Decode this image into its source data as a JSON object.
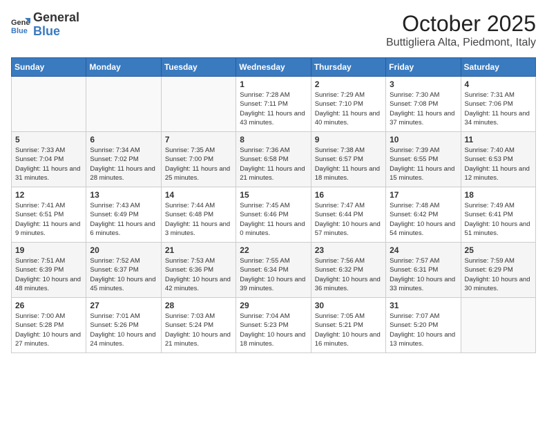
{
  "header": {
    "logo_general": "General",
    "logo_blue": "Blue",
    "month": "October 2025",
    "location": "Buttigliera Alta, Piedmont, Italy"
  },
  "weekdays": [
    "Sunday",
    "Monday",
    "Tuesday",
    "Wednesday",
    "Thursday",
    "Friday",
    "Saturday"
  ],
  "weeks": [
    [
      {
        "day": "",
        "info": ""
      },
      {
        "day": "",
        "info": ""
      },
      {
        "day": "",
        "info": ""
      },
      {
        "day": "1",
        "info": "Sunrise: 7:28 AM\nSunset: 7:11 PM\nDaylight: 11 hours\nand 43 minutes."
      },
      {
        "day": "2",
        "info": "Sunrise: 7:29 AM\nSunset: 7:10 PM\nDaylight: 11 hours\nand 40 minutes."
      },
      {
        "day": "3",
        "info": "Sunrise: 7:30 AM\nSunset: 7:08 PM\nDaylight: 11 hours\nand 37 minutes."
      },
      {
        "day": "4",
        "info": "Sunrise: 7:31 AM\nSunset: 7:06 PM\nDaylight: 11 hours\nand 34 minutes."
      }
    ],
    [
      {
        "day": "5",
        "info": "Sunrise: 7:33 AM\nSunset: 7:04 PM\nDaylight: 11 hours\nand 31 minutes."
      },
      {
        "day": "6",
        "info": "Sunrise: 7:34 AM\nSunset: 7:02 PM\nDaylight: 11 hours\nand 28 minutes."
      },
      {
        "day": "7",
        "info": "Sunrise: 7:35 AM\nSunset: 7:00 PM\nDaylight: 11 hours\nand 25 minutes."
      },
      {
        "day": "8",
        "info": "Sunrise: 7:36 AM\nSunset: 6:58 PM\nDaylight: 11 hours\nand 21 minutes."
      },
      {
        "day": "9",
        "info": "Sunrise: 7:38 AM\nSunset: 6:57 PM\nDaylight: 11 hours\nand 18 minutes."
      },
      {
        "day": "10",
        "info": "Sunrise: 7:39 AM\nSunset: 6:55 PM\nDaylight: 11 hours\nand 15 minutes."
      },
      {
        "day": "11",
        "info": "Sunrise: 7:40 AM\nSunset: 6:53 PM\nDaylight: 11 hours\nand 12 minutes."
      }
    ],
    [
      {
        "day": "12",
        "info": "Sunrise: 7:41 AM\nSunset: 6:51 PM\nDaylight: 11 hours\nand 9 minutes."
      },
      {
        "day": "13",
        "info": "Sunrise: 7:43 AM\nSunset: 6:49 PM\nDaylight: 11 hours\nand 6 minutes."
      },
      {
        "day": "14",
        "info": "Sunrise: 7:44 AM\nSunset: 6:48 PM\nDaylight: 11 hours\nand 3 minutes."
      },
      {
        "day": "15",
        "info": "Sunrise: 7:45 AM\nSunset: 6:46 PM\nDaylight: 11 hours\nand 0 minutes."
      },
      {
        "day": "16",
        "info": "Sunrise: 7:47 AM\nSunset: 6:44 PM\nDaylight: 10 hours\nand 57 minutes."
      },
      {
        "day": "17",
        "info": "Sunrise: 7:48 AM\nSunset: 6:42 PM\nDaylight: 10 hours\nand 54 minutes."
      },
      {
        "day": "18",
        "info": "Sunrise: 7:49 AM\nSunset: 6:41 PM\nDaylight: 10 hours\nand 51 minutes."
      }
    ],
    [
      {
        "day": "19",
        "info": "Sunrise: 7:51 AM\nSunset: 6:39 PM\nDaylight: 10 hours\nand 48 minutes."
      },
      {
        "day": "20",
        "info": "Sunrise: 7:52 AM\nSunset: 6:37 PM\nDaylight: 10 hours\nand 45 minutes."
      },
      {
        "day": "21",
        "info": "Sunrise: 7:53 AM\nSunset: 6:36 PM\nDaylight: 10 hours\nand 42 minutes."
      },
      {
        "day": "22",
        "info": "Sunrise: 7:55 AM\nSunset: 6:34 PM\nDaylight: 10 hours\nand 39 minutes."
      },
      {
        "day": "23",
        "info": "Sunrise: 7:56 AM\nSunset: 6:32 PM\nDaylight: 10 hours\nand 36 minutes."
      },
      {
        "day": "24",
        "info": "Sunrise: 7:57 AM\nSunset: 6:31 PM\nDaylight: 10 hours\nand 33 minutes."
      },
      {
        "day": "25",
        "info": "Sunrise: 7:59 AM\nSunset: 6:29 PM\nDaylight: 10 hours\nand 30 minutes."
      }
    ],
    [
      {
        "day": "26",
        "info": "Sunrise: 7:00 AM\nSunset: 5:28 PM\nDaylight: 10 hours\nand 27 minutes."
      },
      {
        "day": "27",
        "info": "Sunrise: 7:01 AM\nSunset: 5:26 PM\nDaylight: 10 hours\nand 24 minutes."
      },
      {
        "day": "28",
        "info": "Sunrise: 7:03 AM\nSunset: 5:24 PM\nDaylight: 10 hours\nand 21 minutes."
      },
      {
        "day": "29",
        "info": "Sunrise: 7:04 AM\nSunset: 5:23 PM\nDaylight: 10 hours\nand 18 minutes."
      },
      {
        "day": "30",
        "info": "Sunrise: 7:05 AM\nSunset: 5:21 PM\nDaylight: 10 hours\nand 16 minutes."
      },
      {
        "day": "31",
        "info": "Sunrise: 7:07 AM\nSunset: 5:20 PM\nDaylight: 10 hours\nand 13 minutes."
      },
      {
        "day": "",
        "info": ""
      }
    ]
  ]
}
